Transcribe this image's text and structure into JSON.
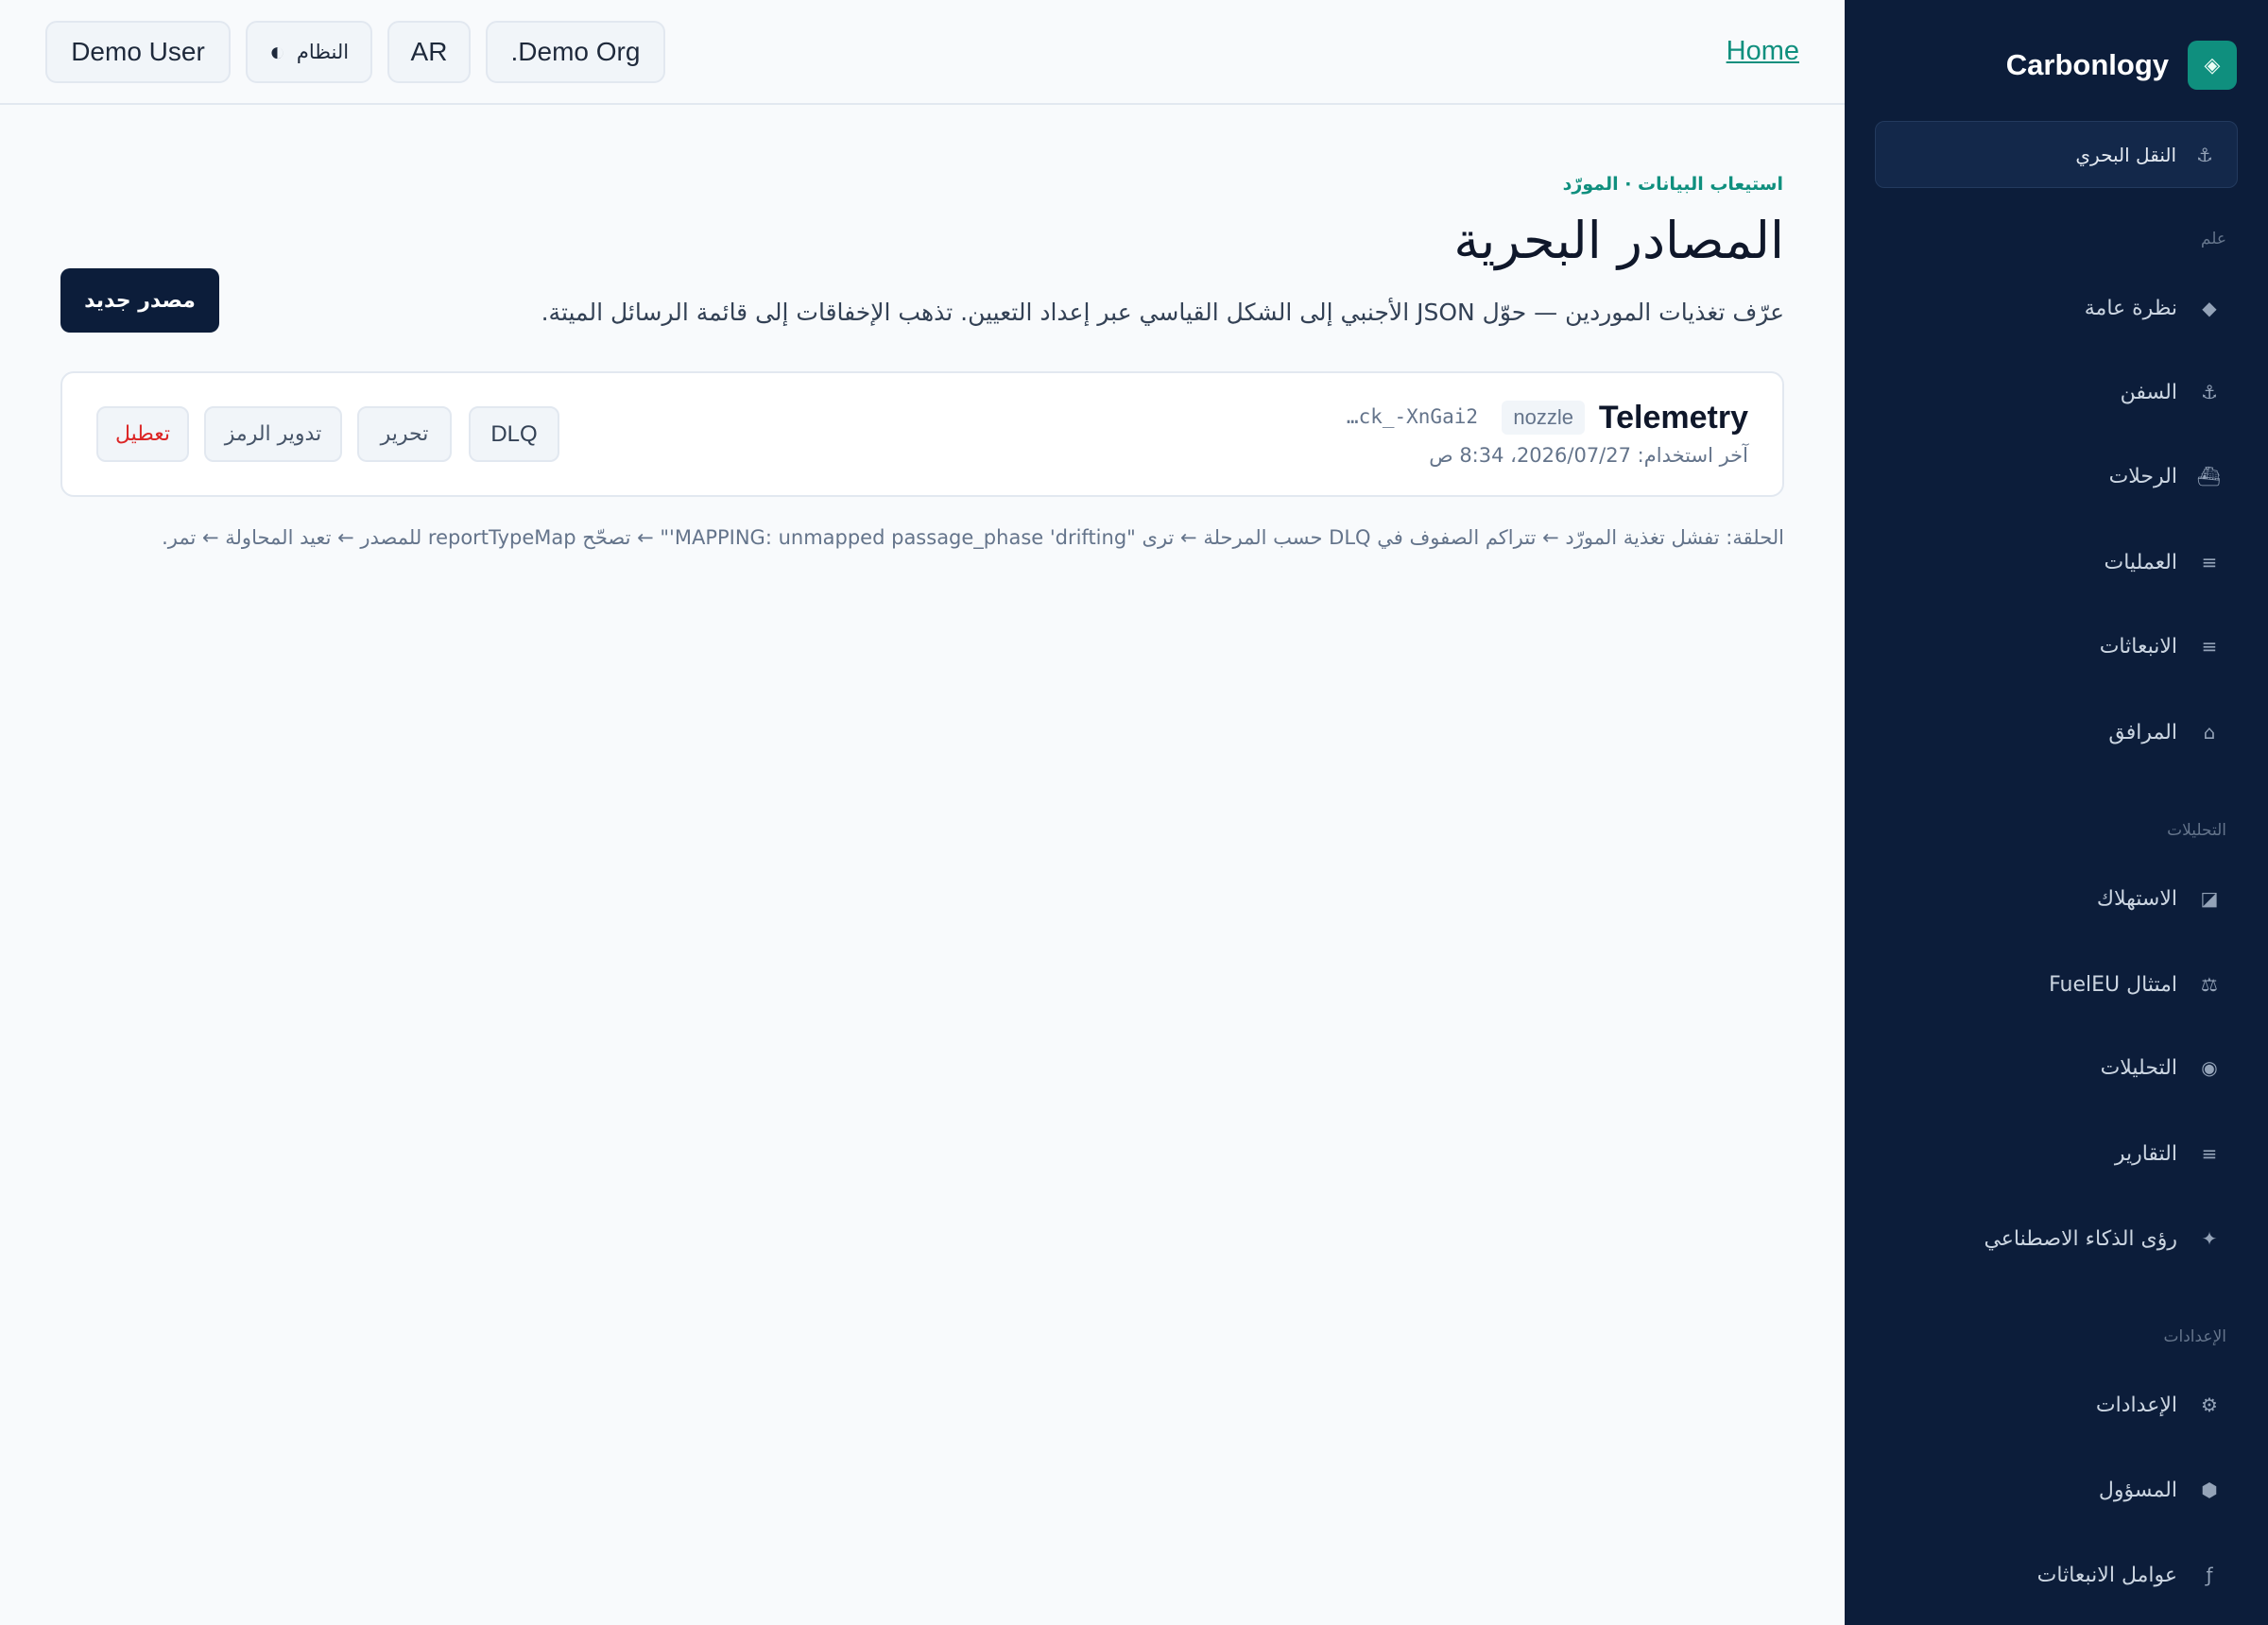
{
  "brand": {
    "name": "Carbonlogy",
    "logo_icon": "◈"
  },
  "topbar": {
    "home_link": "Home",
    "org": ".Demo Org",
    "lang": "AR",
    "theme_label": "النظام",
    "theme_icon": "◐",
    "user": "Demo User"
  },
  "sidebar": {
    "active": {
      "label": "النقل البحري",
      "icon": "⚓"
    },
    "sections": {
      "general": "علم",
      "analytics": "التحليلات",
      "settings": "الإعدادات"
    },
    "items": [
      {
        "label": "نظرة عامة",
        "icon": "◆"
      },
      {
        "label": "السفن",
        "icon": "⚓"
      },
      {
        "label": "الرحلات",
        "icon": "⛴"
      },
      {
        "label": "العمليات",
        "icon": "≡"
      },
      {
        "label": "الانبعاثات",
        "icon": "≡"
      },
      {
        "label": "المرافق",
        "icon": "⌂"
      },
      {
        "label": "الاستهلاك",
        "icon": "◪"
      },
      {
        "label": "امتثال FuelEU",
        "icon": "⚖"
      },
      {
        "label": "التحليلات",
        "icon": "◉"
      },
      {
        "label": "التقارير",
        "icon": "≡"
      },
      {
        "label": "رؤى الذكاء الاصطناعي",
        "icon": "✦"
      },
      {
        "label": "الإعدادات",
        "icon": "⚙"
      },
      {
        "label": "المسؤول",
        "icon": "⬢"
      },
      {
        "label": "عوامل الانبعاثات",
        "icon": "ƒ"
      }
    ]
  },
  "main": {
    "eyebrow": "استيعاب البيانات · المورّد",
    "title": "المصادر البحرية",
    "description": "عرّف تغذيات الموردين — حوّل JSON الأجنبي إلى الشكل القياسي عبر إعداد التعيين. تذهب الإخفاقات إلى قائمة الرسائل الميتة.",
    "new_source_button": "مصدر جديد",
    "source": {
      "name": "Telemetry",
      "tag": "nozzle",
      "token": "…ck_-XnGai2",
      "last_used": "آخر استخدام: 2026/07/27، 8:34 ص",
      "actions": {
        "dlq": "DLQ",
        "edit": "تحرير",
        "rotate": "تدوير الرمز",
        "disable": "تعطيل"
      }
    },
    "loop_note": "الحلقة: تفشل تغذية المورّد ← تتراكم الصفوف في DLQ حسب المرحلة ← ترى \"MAPPING: unmapped passage_phase 'drifting'\" ← تصحّح reportTypeMap للمصدر ← تعيد المحاولة ← تمر."
  },
  "colors": {
    "sidebar_bg": "#0c1d3a",
    "accent": "#0f8f7e",
    "danger": "#dc2626"
  }
}
